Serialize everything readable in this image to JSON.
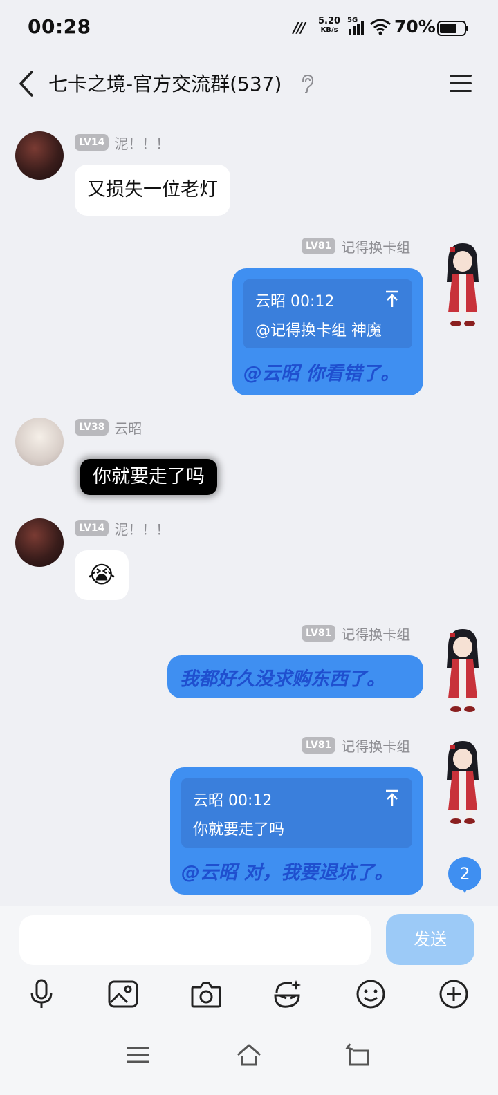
{
  "status_bar": {
    "time": "00:28",
    "net_speed_value": "5.20",
    "net_speed_unit": "KB/s",
    "signal_label": "5G",
    "battery_percent": "70%"
  },
  "header": {
    "title": "七卡之境-官方交流群(537)"
  },
  "messages": [
    {
      "side": "left",
      "level": "LV14",
      "nickname": "泥！！！",
      "text": "又损失一位老灯"
    },
    {
      "side": "right",
      "level": "LV81",
      "nickname": "记得换卡组",
      "quote_header": "云昭 00:12",
      "quote_body": "@记得换卡组 神魔",
      "text": "@云昭 你看错了。"
    },
    {
      "side": "left",
      "level": "LV38",
      "nickname": "云昭",
      "text": "你就要走了吗"
    },
    {
      "side": "left",
      "level": "LV14",
      "nickname": "泥！！！",
      "text": "😭"
    },
    {
      "side": "right",
      "level": "LV81",
      "nickname": "记得换卡组",
      "text": "我都好久没求购东西了。"
    },
    {
      "side": "right",
      "level": "LV81",
      "nickname": "记得换卡组",
      "quote_header": "云昭 00:12",
      "quote_body": "你就要走了吗",
      "text": "@云昭 对，我要退坑了。"
    }
  ],
  "unread_count": "2",
  "input": {
    "send_label": "发送",
    "placeholder": ""
  },
  "toolbar_icons": [
    "microphone-icon",
    "image-icon",
    "camera-icon",
    "face-effect-icon",
    "emoji-icon",
    "plus-icon"
  ],
  "nav_icons": [
    "menu-icon",
    "home-icon",
    "back-icon"
  ],
  "colors": {
    "background": "#eff0f4",
    "bubble_blue": "#3f8ff1",
    "quote_blue": "#3a7fdc",
    "send_button": "#9ccaf7",
    "level_badge": "#b9b9bd"
  }
}
